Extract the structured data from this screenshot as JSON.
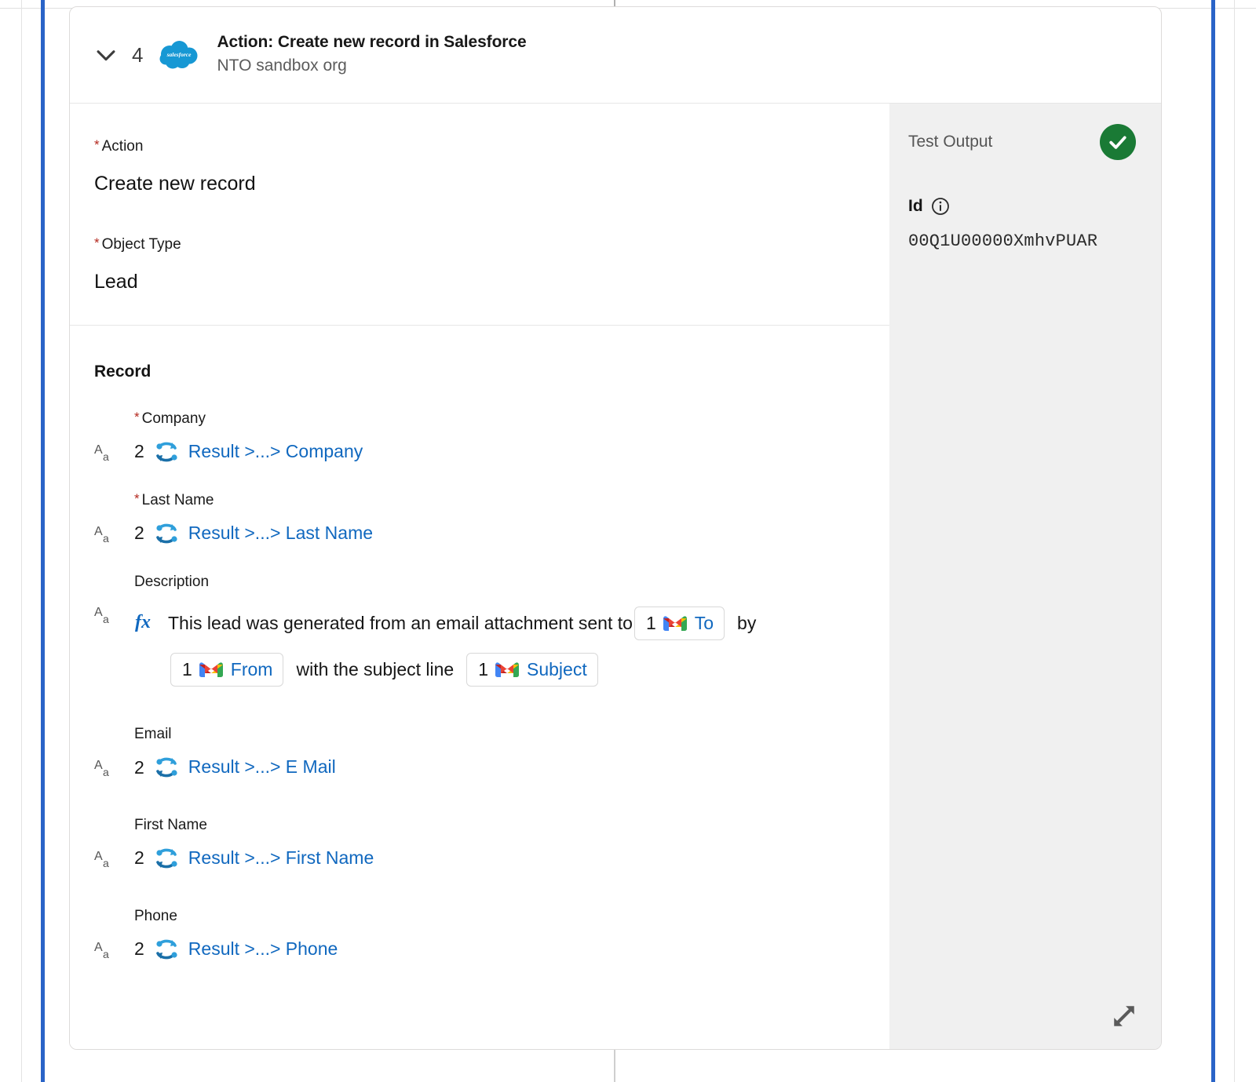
{
  "step": {
    "number": "4",
    "title": "Action: Create new record in Salesforce",
    "subtitle": "NTO sandbox org",
    "app_icon": "salesforce-icon",
    "collapse_icon": "chevron-down-icon"
  },
  "config": {
    "action": {
      "label": "Action",
      "required": true,
      "value": "Create new record"
    },
    "object_type": {
      "label": "Object Type",
      "required": true,
      "value": "Lead"
    }
  },
  "record": {
    "heading": "Record",
    "fields": [
      {
        "label": "Company",
        "required": true,
        "type_icon": "text-format-icon",
        "step": "2",
        "source_icon": "loop-arrows-icon",
        "reference": "Result >...> Company"
      },
      {
        "label": "Last Name",
        "required": true,
        "type_icon": "text-format-icon",
        "step": "2",
        "source_icon": "loop-arrows-icon",
        "reference": "Result >...> Last Name"
      },
      {
        "label": "Email",
        "required": false,
        "type_icon": "text-format-icon",
        "step": "2",
        "source_icon": "loop-arrows-icon",
        "reference": "Result >...> E Mail"
      },
      {
        "label": "First Name",
        "required": false,
        "type_icon": "text-format-icon",
        "step": "2",
        "source_icon": "loop-arrows-icon",
        "reference": "Result >...> First Name"
      },
      {
        "label": "Phone",
        "required": false,
        "type_icon": "text-format-icon",
        "step": "2",
        "source_icon": "loop-arrows-icon",
        "reference": "Result >...> Phone"
      }
    ],
    "description": {
      "label": "Description",
      "type_icon": "text-format-icon",
      "formula_icon": "fx-icon",
      "text_1": "This lead was generated from an email attachment sent to",
      "token_1": {
        "step": "1",
        "icon": "gmail-icon",
        "label": "To"
      },
      "text_2": "by",
      "token_2": {
        "step": "1",
        "icon": "gmail-icon",
        "label": "From"
      },
      "text_3": "with the subject line",
      "token_3": {
        "step": "1",
        "icon": "gmail-icon",
        "label": "Subject"
      }
    }
  },
  "test_output": {
    "title": "Test Output",
    "status_icon": "check-circle-icon",
    "status_color": "#1a7a35",
    "key": "Id",
    "info_icon": "info-circle-icon",
    "value": "00Q1U00000XmhvPUAR",
    "expand_icon": "expand-arrows-icon"
  },
  "colors": {
    "link": "#1068bf",
    "required_star": "#b4281e",
    "rail_blue": "#2a64c8",
    "panel_gray": "#f0f0f0",
    "success_green": "#1a7a35"
  }
}
